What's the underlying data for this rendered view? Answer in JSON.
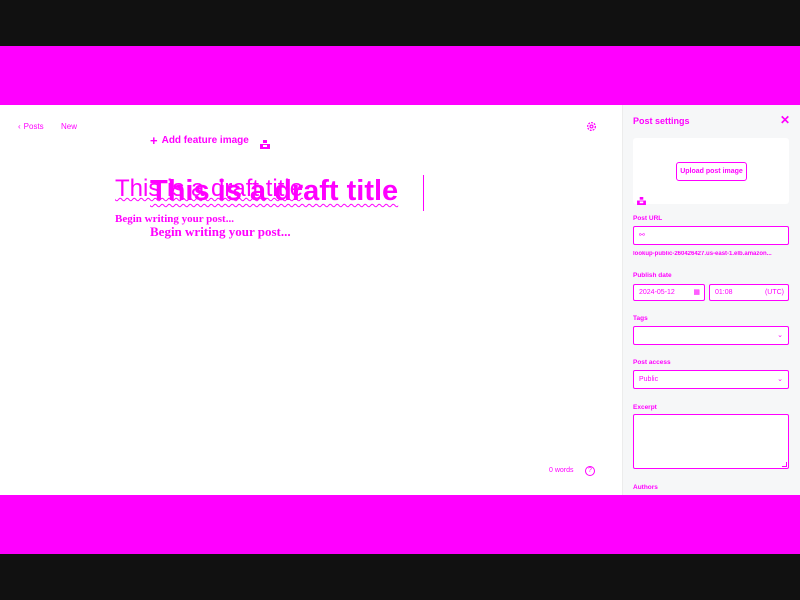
{
  "editor": {
    "back_label": "Posts",
    "status_label": "New",
    "feature_image_label": "Add feature image",
    "title_ghost": "This is a draft title",
    "title": "This is a draft title",
    "body_ghost": "Begin writing your post...",
    "body_placeholder": "Begin writing your post...",
    "word_count": "0 words",
    "help_label": "?"
  },
  "panel": {
    "title": "Post settings",
    "upload_label": "Upload post image",
    "post_url_label": "Post URL",
    "post_url_value": "",
    "post_url_note": "lookup-public-260426427.us-east-1.elb.amazon...",
    "publish_date_label": "Publish date",
    "publish_date": "2024-05-12",
    "publish_time": "01:08",
    "timezone": "(UTC)",
    "tags_label": "Tags",
    "tags_value": "",
    "access_label": "Post access",
    "access_value": "Public",
    "excerpt_label": "Excerpt",
    "excerpt_value": "",
    "authors_label": "Authors"
  },
  "colors": {
    "accent": "#ff00ff",
    "frame": "#111111",
    "panel_bg": "#f6f7f8"
  },
  "icons": {
    "back": "chevron-left-icon",
    "settings": "gear-icon",
    "add": "plus-icon",
    "unsplash": "unsplash-icon",
    "close": "close-icon",
    "link": "link-icon",
    "calendar": "calendar-icon",
    "dropdown": "chevron-down-icon",
    "help": "help-circle-icon"
  }
}
